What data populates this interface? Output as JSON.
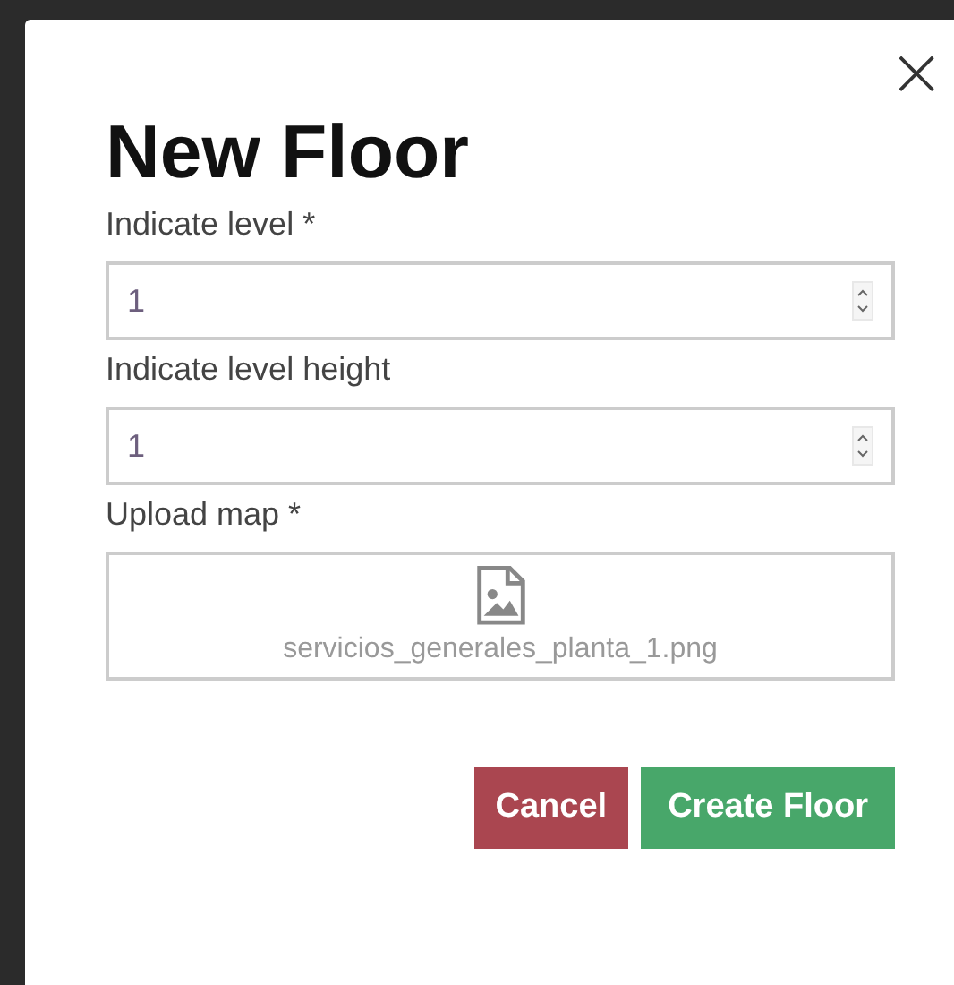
{
  "dialog": {
    "close": "×",
    "title": "New Floor"
  },
  "fields": [
    {
      "label": "Indicate level *",
      "value": "1"
    },
    {
      "label": "Indicate level height",
      "value": "1"
    }
  ],
  "upload": {
    "label": "Upload map *",
    "filename": "servicios_generales_planta_1.png"
  },
  "buttons": [
    {
      "label": "Cancel",
      "kind": "danger"
    },
    {
      "label": "Create Floor",
      "kind": "primary"
    }
  ]
}
